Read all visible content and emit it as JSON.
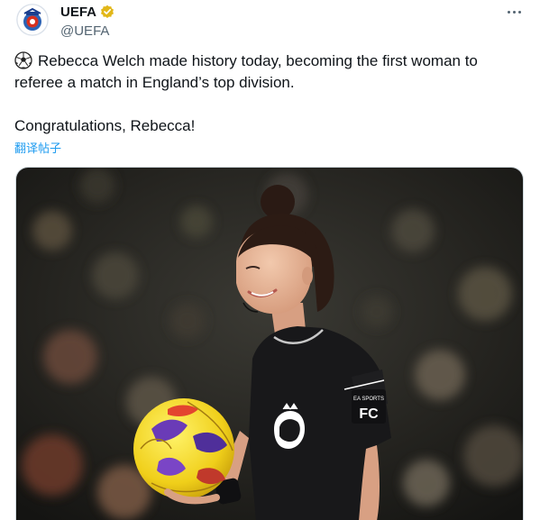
{
  "author": {
    "display_name": "UEFA",
    "handle": "@UEFA",
    "avatar_icon": "uefa-logo-icon",
    "verified_badge_icon": "verified-gold-badge-icon",
    "verified_color": "#e2b719"
  },
  "more_menu_icon": "more-horizontal-icon",
  "tweet": {
    "emoji_icon": "soccer-ball-icon",
    "line1": "Rebecca Welch made history today, becoming the first woman to",
    "line2": "referee a match in England’s top division.",
    "line3": "Congratulations, Rebecca!"
  },
  "translate_label": "翻译帖子",
  "media": {
    "kit_sponsor_text": "EA SPORTS",
    "kit_badge_text": "FC"
  },
  "colors": {
    "text_primary": "#0f1419",
    "text_secondary": "#536471",
    "link": "#1d9bf0"
  }
}
